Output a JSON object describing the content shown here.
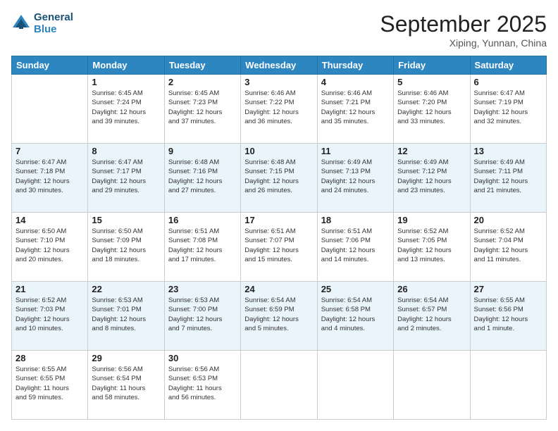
{
  "header": {
    "logo_line1": "General",
    "logo_line2": "Blue",
    "month_title": "September 2025",
    "location": "Xiping, Yunnan, China"
  },
  "days_of_week": [
    "Sunday",
    "Monday",
    "Tuesday",
    "Wednesday",
    "Thursday",
    "Friday",
    "Saturday"
  ],
  "weeks": [
    [
      {
        "day": "",
        "detail": ""
      },
      {
        "day": "1",
        "detail": "Sunrise: 6:45 AM\nSunset: 7:24 PM\nDaylight: 12 hours\nand 39 minutes."
      },
      {
        "day": "2",
        "detail": "Sunrise: 6:45 AM\nSunset: 7:23 PM\nDaylight: 12 hours\nand 37 minutes."
      },
      {
        "day": "3",
        "detail": "Sunrise: 6:46 AM\nSunset: 7:22 PM\nDaylight: 12 hours\nand 36 minutes."
      },
      {
        "day": "4",
        "detail": "Sunrise: 6:46 AM\nSunset: 7:21 PM\nDaylight: 12 hours\nand 35 minutes."
      },
      {
        "day": "5",
        "detail": "Sunrise: 6:46 AM\nSunset: 7:20 PM\nDaylight: 12 hours\nand 33 minutes."
      },
      {
        "day": "6",
        "detail": "Sunrise: 6:47 AM\nSunset: 7:19 PM\nDaylight: 12 hours\nand 32 minutes."
      }
    ],
    [
      {
        "day": "7",
        "detail": "Sunrise: 6:47 AM\nSunset: 7:18 PM\nDaylight: 12 hours\nand 30 minutes."
      },
      {
        "day": "8",
        "detail": "Sunrise: 6:47 AM\nSunset: 7:17 PM\nDaylight: 12 hours\nand 29 minutes."
      },
      {
        "day": "9",
        "detail": "Sunrise: 6:48 AM\nSunset: 7:16 PM\nDaylight: 12 hours\nand 27 minutes."
      },
      {
        "day": "10",
        "detail": "Sunrise: 6:48 AM\nSunset: 7:15 PM\nDaylight: 12 hours\nand 26 minutes."
      },
      {
        "day": "11",
        "detail": "Sunrise: 6:49 AM\nSunset: 7:13 PM\nDaylight: 12 hours\nand 24 minutes."
      },
      {
        "day": "12",
        "detail": "Sunrise: 6:49 AM\nSunset: 7:12 PM\nDaylight: 12 hours\nand 23 minutes."
      },
      {
        "day": "13",
        "detail": "Sunrise: 6:49 AM\nSunset: 7:11 PM\nDaylight: 12 hours\nand 21 minutes."
      }
    ],
    [
      {
        "day": "14",
        "detail": "Sunrise: 6:50 AM\nSunset: 7:10 PM\nDaylight: 12 hours\nand 20 minutes."
      },
      {
        "day": "15",
        "detail": "Sunrise: 6:50 AM\nSunset: 7:09 PM\nDaylight: 12 hours\nand 18 minutes."
      },
      {
        "day": "16",
        "detail": "Sunrise: 6:51 AM\nSunset: 7:08 PM\nDaylight: 12 hours\nand 17 minutes."
      },
      {
        "day": "17",
        "detail": "Sunrise: 6:51 AM\nSunset: 7:07 PM\nDaylight: 12 hours\nand 15 minutes."
      },
      {
        "day": "18",
        "detail": "Sunrise: 6:51 AM\nSunset: 7:06 PM\nDaylight: 12 hours\nand 14 minutes."
      },
      {
        "day": "19",
        "detail": "Sunrise: 6:52 AM\nSunset: 7:05 PM\nDaylight: 12 hours\nand 13 minutes."
      },
      {
        "day": "20",
        "detail": "Sunrise: 6:52 AM\nSunset: 7:04 PM\nDaylight: 12 hours\nand 11 minutes."
      }
    ],
    [
      {
        "day": "21",
        "detail": "Sunrise: 6:52 AM\nSunset: 7:03 PM\nDaylight: 12 hours\nand 10 minutes."
      },
      {
        "day": "22",
        "detail": "Sunrise: 6:53 AM\nSunset: 7:01 PM\nDaylight: 12 hours\nand 8 minutes."
      },
      {
        "day": "23",
        "detail": "Sunrise: 6:53 AM\nSunset: 7:00 PM\nDaylight: 12 hours\nand 7 minutes."
      },
      {
        "day": "24",
        "detail": "Sunrise: 6:54 AM\nSunset: 6:59 PM\nDaylight: 12 hours\nand 5 minutes."
      },
      {
        "day": "25",
        "detail": "Sunrise: 6:54 AM\nSunset: 6:58 PM\nDaylight: 12 hours\nand 4 minutes."
      },
      {
        "day": "26",
        "detail": "Sunrise: 6:54 AM\nSunset: 6:57 PM\nDaylight: 12 hours\nand 2 minutes."
      },
      {
        "day": "27",
        "detail": "Sunrise: 6:55 AM\nSunset: 6:56 PM\nDaylight: 12 hours\nand 1 minute."
      }
    ],
    [
      {
        "day": "28",
        "detail": "Sunrise: 6:55 AM\nSunset: 6:55 PM\nDaylight: 11 hours\nand 59 minutes."
      },
      {
        "day": "29",
        "detail": "Sunrise: 6:56 AM\nSunset: 6:54 PM\nDaylight: 11 hours\nand 58 minutes."
      },
      {
        "day": "30",
        "detail": "Sunrise: 6:56 AM\nSunset: 6:53 PM\nDaylight: 11 hours\nand 56 minutes."
      },
      {
        "day": "",
        "detail": ""
      },
      {
        "day": "",
        "detail": ""
      },
      {
        "day": "",
        "detail": ""
      },
      {
        "day": "",
        "detail": ""
      }
    ]
  ]
}
